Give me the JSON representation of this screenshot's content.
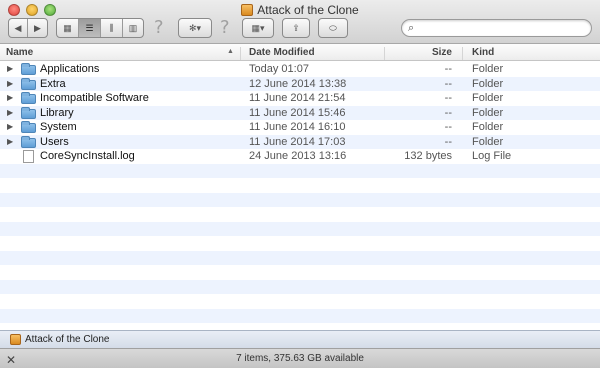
{
  "window": {
    "title": "Attack of the Clone"
  },
  "toolbar": {
    "back_glyph": "◀",
    "forward_glyph": "▶",
    "view_icons_glyph": "▦",
    "view_list_glyph": "☰",
    "view_columns_glyph": "⫼",
    "view_coverflow_glyph": "▥",
    "help_glyph": "?",
    "action_glyph": "✻▾",
    "arrange_glyph": "▦▾",
    "share_glyph": "⇪",
    "tags_glyph": "⬭",
    "search_glyph": "⌕",
    "search_value": ""
  },
  "columns": {
    "name": "Name",
    "date": "Date Modified",
    "size": "Size",
    "kind": "Kind"
  },
  "rows": [
    {
      "name": "Applications",
      "date": "Today 01:07",
      "size": "--",
      "kind": "Folder",
      "type": "folder"
    },
    {
      "name": "Extra",
      "date": "12 June 2014 13:38",
      "size": "--",
      "kind": "Folder",
      "type": "folder"
    },
    {
      "name": "Incompatible Software",
      "date": "11 June 2014 21:54",
      "size": "--",
      "kind": "Folder",
      "type": "folder"
    },
    {
      "name": "Library",
      "date": "11 June 2014 15:46",
      "size": "--",
      "kind": "Folder",
      "type": "folder"
    },
    {
      "name": "System",
      "date": "11 June 2014 16:10",
      "size": "--",
      "kind": "Folder",
      "type": "folder"
    },
    {
      "name": "Users",
      "date": "11 June 2014 17:03",
      "size": "--",
      "kind": "Folder",
      "type": "folder"
    },
    {
      "name": "CoreSyncInstall.log",
      "date": "24 June 2013 13:16",
      "size": "132 bytes",
      "kind": "Log File",
      "type": "file"
    }
  ],
  "pathbar": {
    "label": "Attack of the Clone"
  },
  "status": {
    "text": "7 items, 375.63 GB available",
    "tool_glyph": "✕"
  }
}
